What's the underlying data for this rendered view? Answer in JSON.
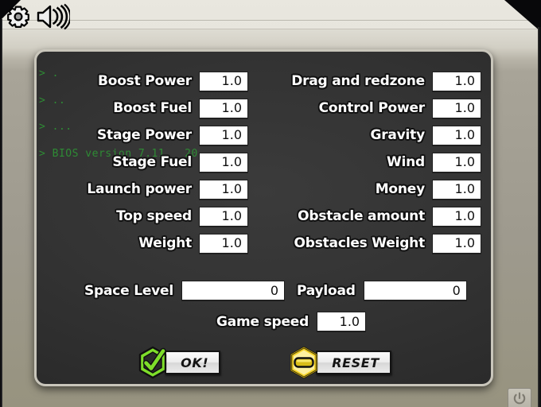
{
  "window": {
    "titlebar_icons": [
      {
        "name": "gear-icon",
        "label": "settings"
      },
      {
        "name": "speaker-icon",
        "label": "sound"
      }
    ],
    "power_button_icon": "power-icon"
  },
  "console": {
    "boot_lines": [
      "> .",
      "> ..",
      "> ...",
      "> BIOS version 7.11   20"
    ]
  },
  "settings": {
    "left_column": [
      {
        "label": "Boost Power",
        "value": "1.0"
      },
      {
        "label": "Boost Fuel",
        "value": "1.0"
      },
      {
        "label": "Stage Power",
        "value": "1.0"
      },
      {
        "label": "Stage Fuel",
        "value": "1.0"
      },
      {
        "label": "Launch power",
        "value": "1.0"
      },
      {
        "label": "Top speed",
        "value": "1.0"
      },
      {
        "label": "Weight",
        "value": "1.0"
      }
    ],
    "right_column": [
      {
        "label": "Drag and redzone",
        "value": "1.0"
      },
      {
        "label": "Control Power",
        "value": "1.0"
      },
      {
        "label": "Gravity",
        "value": "1.0"
      },
      {
        "label": "Wind",
        "value": "1.0"
      },
      {
        "label": "Money",
        "value": "1.0"
      },
      {
        "label": "Obstacle amount",
        "value": "1.0"
      },
      {
        "label": "Obstacles Weight",
        "value": "1.0"
      }
    ],
    "space_level": {
      "label": "Space Level",
      "value": "0"
    },
    "payload": {
      "label": "Payload",
      "value": "0"
    },
    "game_speed": {
      "label": "Game speed",
      "value": "1.0"
    }
  },
  "actions": {
    "ok": {
      "label": "OK!",
      "icon": "check-badge-icon",
      "color": "#7ede2a"
    },
    "reset": {
      "label": "RESET",
      "icon": "reset-badge-icon",
      "color": "#f2d024"
    }
  },
  "colors": {
    "panel_bg": "#333333",
    "panel_border": "#c9c6bb",
    "shell_top": "#e9e7df",
    "shell_bottom": "#97937f",
    "boot_text": "#2e8b34",
    "label_text": "#ffffff",
    "field_bg": "#ffffff"
  }
}
